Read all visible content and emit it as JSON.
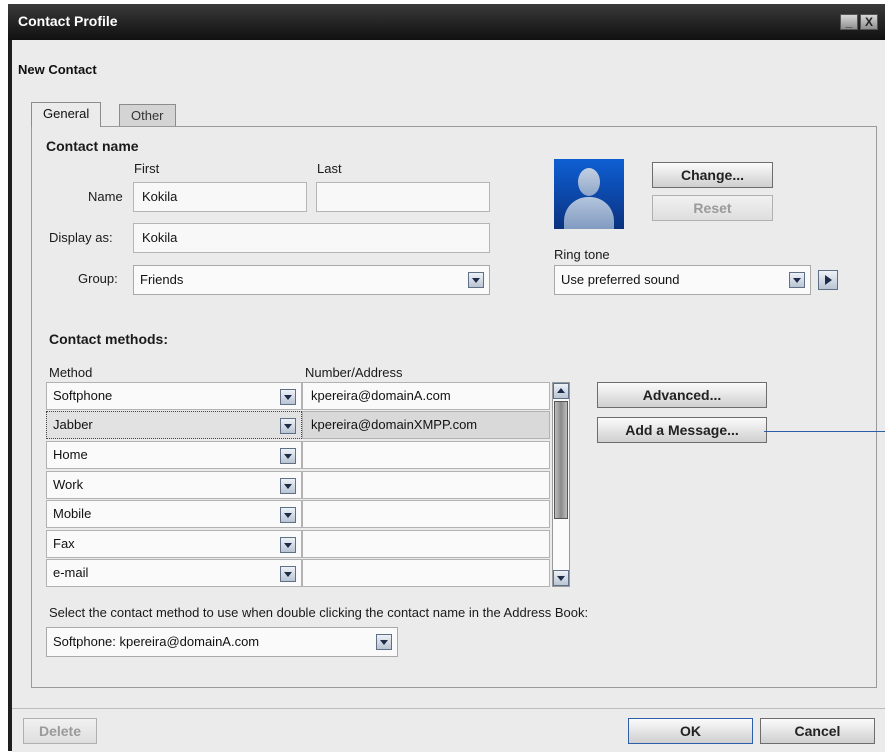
{
  "window": {
    "title": "Contact Profile",
    "minimize_glyph": "_",
    "close_glyph": "X"
  },
  "subtitle": "New Contact",
  "tabs": [
    {
      "label": "General",
      "active": true
    },
    {
      "label": "Other",
      "active": false
    }
  ],
  "contact_name": {
    "heading": "Contact name",
    "first_label": "First",
    "last_label": "Last",
    "name_label": "Name",
    "first_value": "Kokila",
    "last_value": "",
    "display_label": "Display as:",
    "display_value": "Kokila",
    "group_label": "Group:",
    "group_value": "Friends"
  },
  "photo": {
    "icon": "user-silhouette-icon",
    "change_label": "Change...",
    "reset_label": "Reset"
  },
  "ringtone": {
    "label": "Ring tone",
    "value": "Use preferred sound",
    "play_icon": "play-icon"
  },
  "contact_methods": {
    "heading": "Contact methods:",
    "method_header": "Method",
    "address_header": "Number/Address",
    "rows": [
      {
        "method": "Softphone",
        "address": "kpereira@domainA.com",
        "selected": false
      },
      {
        "method": "Jabber",
        "address": "kpereira@domainXMPP.com",
        "selected": true
      },
      {
        "method": "Home",
        "address": "",
        "selected": false
      },
      {
        "method": "Work",
        "address": "",
        "selected": false
      },
      {
        "method": "Mobile",
        "address": "",
        "selected": false
      },
      {
        "method": "Fax",
        "address": "",
        "selected": false
      },
      {
        "method": "e-mail",
        "address": "",
        "selected": false
      }
    ],
    "advanced_label": "Advanced...",
    "add_message_label": "Add a Message..."
  },
  "default_method": {
    "prompt": "Select the contact method to use when double clicking the contact name in the Address Book:",
    "value": "Softphone: kpereira@domainA.com"
  },
  "footer": {
    "delete_label": "Delete",
    "ok_label": "OK",
    "cancel_label": "Cancel"
  },
  "colors": {
    "accent": "#2d5fa8",
    "titlebar": "#1e1e1e",
    "panel": "#ebebeb"
  }
}
